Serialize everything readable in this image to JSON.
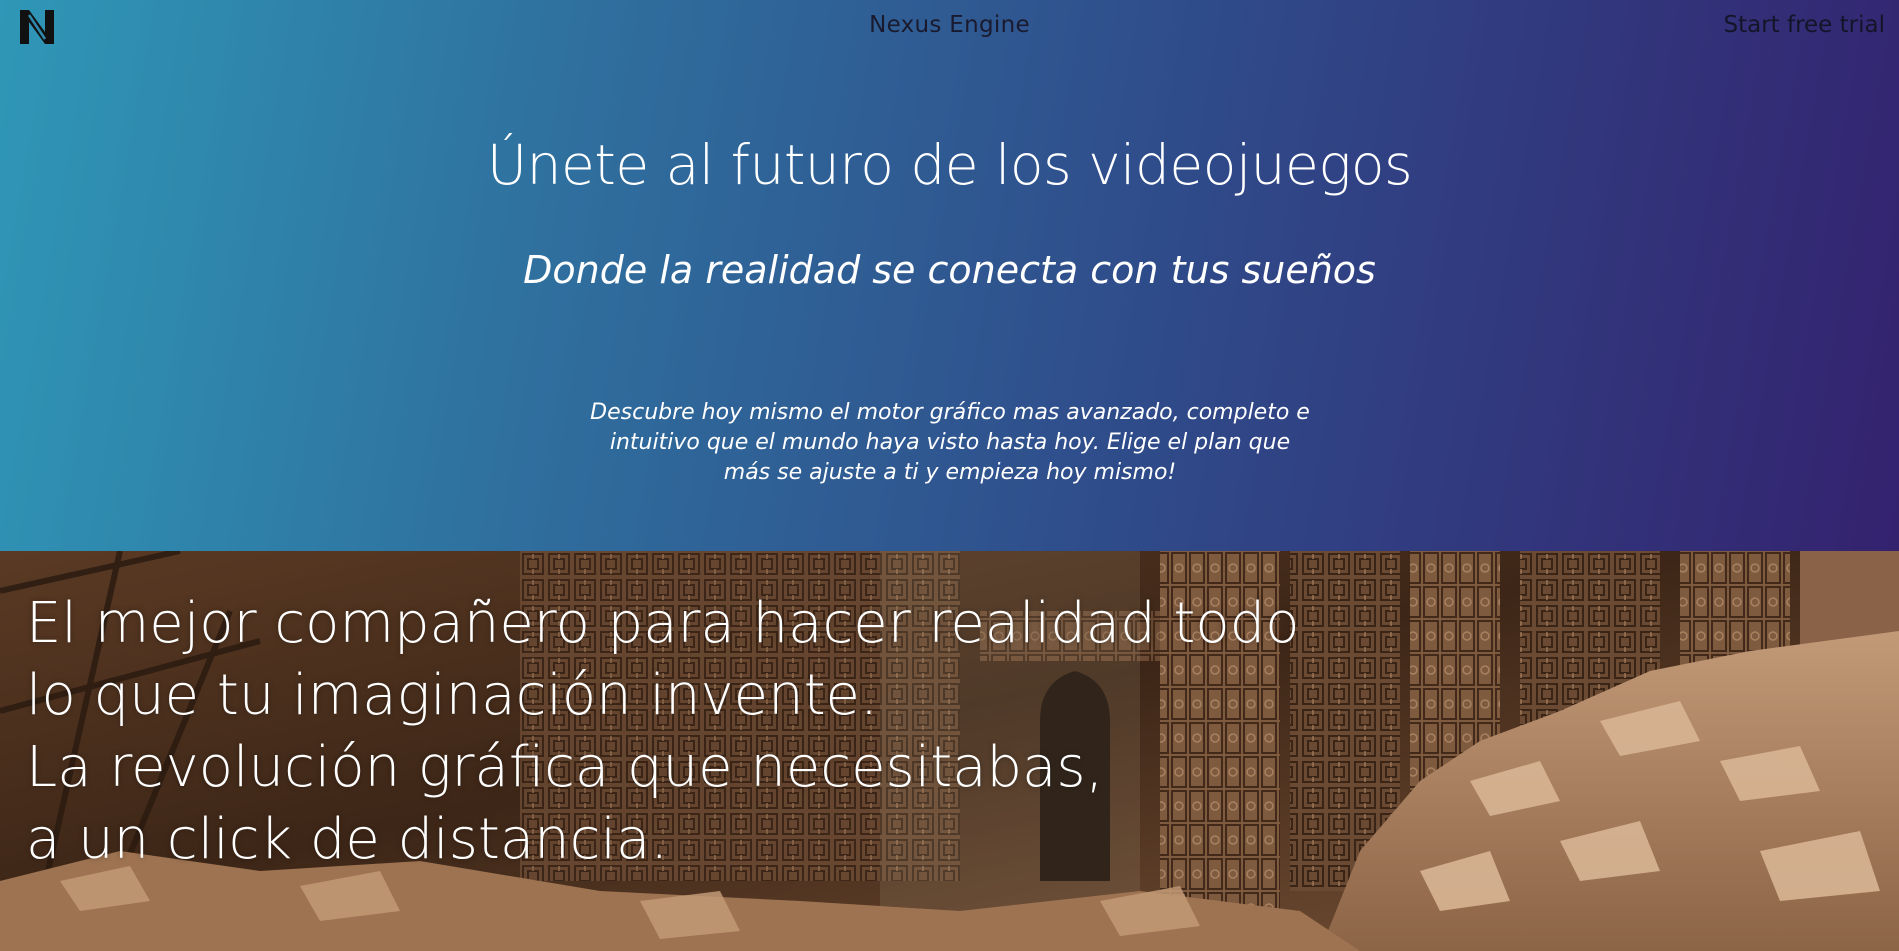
{
  "header": {
    "logo_icon": "nexus-n-logo-icon",
    "brand": "Nexus Engine",
    "cta_label": "Start free trial"
  },
  "hero": {
    "title": "Únete al futuro de los videojuegos",
    "subtitle": "Donde la realidad se conecta con tus sueños",
    "description": [
      "Descubre hoy mismo el motor gráfico mas avanzado, completo e",
      "intuitivo que el mundo haya visto hasta hoy. Elige el plan que",
      "más se ajuste a ti y empieza hoy mismo!"
    ],
    "colors": {
      "gradient_start": "#2f97b7",
      "gradient_end": "#34226f"
    }
  },
  "feature_band": {
    "background": "ancient-temple-ruins-image",
    "lines": [
      "El mejor compañero para hacer realidad todo",
      "lo que tu imaginación invente.",
      "La revolución gráfica que necesitabas,",
      "a un click de distancia."
    ]
  }
}
